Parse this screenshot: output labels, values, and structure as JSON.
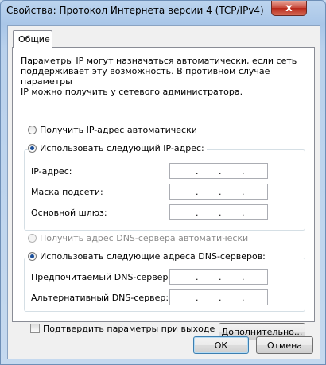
{
  "window": {
    "title": "Свойства: Протокол Интернета версии 4 (TCP/IPv4)",
    "close_glyph": "x"
  },
  "tabs": [
    {
      "label": "Общие",
      "selected": true
    }
  ],
  "description": "Параметры IP могут назначаться автоматически, если сеть\nподдерживает эту возможность. В противном случае параметры\nIP можно получить у сетевого администратора.",
  "ip": {
    "auto_label": "Получить IP-адрес автоматически",
    "manual_label": "Использовать следующий IP-адрес:",
    "selected": "manual",
    "fields": [
      {
        "label": "IP-адрес:",
        "value": ""
      },
      {
        "label": "Маска подсети:",
        "value": ""
      },
      {
        "label": "Основной шлюз:",
        "value": ""
      }
    ]
  },
  "dns": {
    "auto_label": "Получить адрес DNS-сервера автоматически",
    "auto_disabled": true,
    "manual_label": "Использовать следующие адреса DNS-серверов:",
    "selected": "manual",
    "fields": [
      {
        "label": "Предпочитаемый DNS-сервер:",
        "value": ""
      },
      {
        "label": "Альтернативный DNS-сервер:",
        "value": ""
      }
    ]
  },
  "ip_separator": ".",
  "validate_label": "Подтвердить параметры при выходе",
  "validate_checked": false,
  "buttons": {
    "advanced": "Дополнительно...",
    "ok": "ОК",
    "cancel": "Отмена"
  }
}
